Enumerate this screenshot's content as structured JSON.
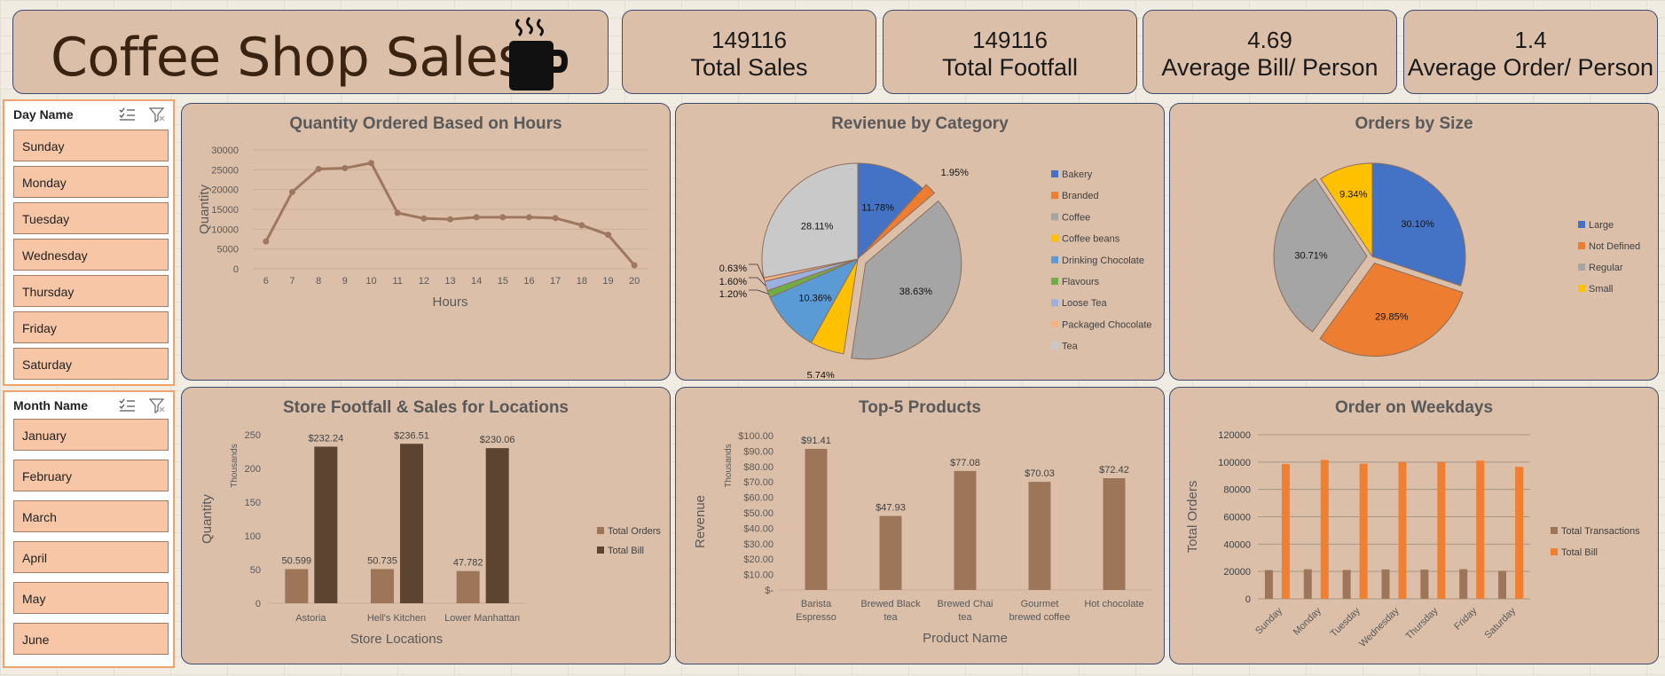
{
  "header": {
    "title": "Coffee Shop Sales",
    "cup_icon": "coffee-cup-icon"
  },
  "kpis": [
    {
      "value": "149116",
      "label": "Total Sales"
    },
    {
      "value": "149116",
      "label": "Total Footfall"
    },
    {
      "value": "4.69",
      "label": "Average Bill/ Person"
    },
    {
      "value": "1.4",
      "label": "Average Order/ Person"
    }
  ],
  "slicers": {
    "day": {
      "title": "Day Name",
      "items": [
        "Sunday",
        "Monday",
        "Tuesday",
        "Wednesday",
        "Thursday",
        "Friday",
        "Saturday"
      ]
    },
    "month": {
      "title": "Month Name",
      "items": [
        "January",
        "February",
        "March",
        "April",
        "May",
        "June"
      ]
    }
  },
  "colors": {
    "card": "#dbbfa9",
    "line": "#9e7760",
    "bar_light": "#9d7558",
    "bar_dark": "#5c4430",
    "orange": "#f07f32",
    "slicer_btn": "#f7c6a6"
  },
  "chart_data": [
    {
      "type": "line",
      "title": "Quantity Ordered Based on Hours",
      "xlabel": "Hours",
      "ylabel": "Quantity",
      "x": [
        6,
        7,
        8,
        9,
        10,
        11,
        12,
        13,
        14,
        15,
        16,
        17,
        18,
        19,
        20
      ],
      "y": [
        6900,
        19400,
        25200,
        25400,
        26700,
        14100,
        12700,
        12500,
        13000,
        13000,
        13000,
        12800,
        11000,
        8600,
        900
      ],
      "ylim": [
        0,
        30000
      ],
      "yticks": [
        "0",
        "5000",
        "10000",
        "15000",
        "20000",
        "25000",
        "30000"
      ],
      "grid": true
    },
    {
      "type": "pie",
      "title": "Revienue by Category",
      "legend": "right",
      "slices": [
        {
          "label": "Bakery",
          "value": 11.78,
          "text": "11.78%",
          "color": "#4472c4"
        },
        {
          "label": "Branded",
          "value": 1.95,
          "text": "1.95%",
          "color": "#ed7d31"
        },
        {
          "label": "Coffee",
          "value": 38.63,
          "text": "38.63%",
          "color": "#a5a5a5"
        },
        {
          "label": "Coffee beans",
          "value": 5.74,
          "text": "5.74%",
          "color": "#ffc000"
        },
        {
          "label": "Drinking Chocolate",
          "value": 10.36,
          "text": "10.36%",
          "color": "#5b9bd5"
        },
        {
          "label": "Flavours",
          "value": 1.2,
          "text": "1.20%",
          "color": "#70ad47"
        },
        {
          "label": "Loose Tea",
          "value": 1.6,
          "text": "1.60%",
          "color": "#9cb0e0"
        },
        {
          "label": "Packaged Chocolate",
          "value": 0.63,
          "text": "0.63%",
          "color": "#f4b183"
        },
        {
          "label": "Tea",
          "value": 28.11,
          "text": "28.11%",
          "color": "#c9c9c9"
        }
      ]
    },
    {
      "type": "pie",
      "title": "Orders by Size",
      "legend": "right",
      "slices": [
        {
          "label": "Large",
          "value": 30.1,
          "text": "30.10%",
          "color": "#4472c4"
        },
        {
          "label": "Not Defined",
          "value": 29.85,
          "text": "29.85%",
          "color": "#ed7d31"
        },
        {
          "label": "Regular",
          "value": 30.71,
          "text": "30.71%",
          "color": "#a5a5a5"
        },
        {
          "label": "Small",
          "value": 9.34,
          "text": "9.34%",
          "color": "#ffc000"
        }
      ]
    },
    {
      "type": "bar",
      "title": "Store Footfall & Sales for Locations",
      "xlabel": "Store Locations",
      "ylabel": "Quantity",
      "units": "Thousands",
      "categories": [
        "Astoria",
        "Hell's Kitchen",
        "Lower Manhattan"
      ],
      "ylim": [
        0,
        250
      ],
      "yticks": [
        "0",
        "50",
        "100",
        "150",
        "200",
        "250"
      ],
      "series": [
        {
          "name": "Total Orders",
          "values": [
            50.599,
            50.735,
            47.782
          ],
          "labels": [
            "50.599",
            "50.735",
            "47.782"
          ]
        },
        {
          "name": "Total Bill",
          "values": [
            232.24,
            236.51,
            230.06
          ],
          "labels": [
            "$232.24",
            "$236.51",
            "$230.06"
          ]
        }
      ]
    },
    {
      "type": "bar",
      "title": "Top-5 Products",
      "xlabel": "Product Name",
      "ylabel": "Revenue",
      "units": "Thousands",
      "categories": [
        [
          "Barista",
          "Espresso"
        ],
        [
          "Brewed Black",
          "tea"
        ],
        [
          "Brewed Chai",
          "tea"
        ],
        [
          "Gourmet",
          "brewed coffee"
        ],
        [
          "Hot chocolate"
        ]
      ],
      "ylim": [
        0,
        100
      ],
      "yticks": [
        "$-",
        "$10.00",
        "$20.00",
        "$30.00",
        "$40.00",
        "$50.00",
        "$60.00",
        "$70.00",
        "$80.00",
        "$90.00",
        "$100.00"
      ],
      "values": [
        91.41,
        47.93,
        77.08,
        70.03,
        72.42
      ],
      "labels": [
        "$91.41",
        "$47.93",
        "$77.08",
        "$70.03",
        "$72.42"
      ]
    },
    {
      "type": "bar",
      "title": "Order on Weekdays",
      "ylabel": "Total Orders",
      "categories": [
        "Sunday",
        "Monday",
        "Tuesday",
        "Wednesday",
        "Thursday",
        "Friday",
        "Saturday"
      ],
      "ylim": [
        0,
        120000
      ],
      "yticks": [
        "0",
        "20000",
        "40000",
        "60000",
        "80000",
        "100000",
        "120000"
      ],
      "series": [
        {
          "name": "Total Transactions",
          "values": [
            21000,
            21600,
            21100,
            21500,
            21400,
            21700,
            20500
          ]
        },
        {
          "name": "Total Bill",
          "values": [
            98500,
            101500,
            98800,
            100000,
            100000,
            101000,
            96500
          ]
        }
      ]
    }
  ]
}
